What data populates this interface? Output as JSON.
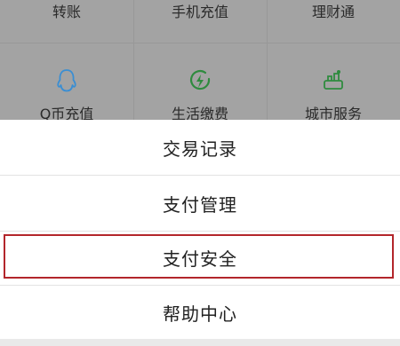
{
  "grid": {
    "row1": [
      {
        "label": "转账"
      },
      {
        "label": "手机充值"
      },
      {
        "label": "理财通"
      }
    ],
    "row2": [
      {
        "label": "Q币充值",
        "icon": "penguin-outline-icon",
        "color": "#3a8ed3"
      },
      {
        "label": "生活缴费",
        "icon": "bolt-ring-icon",
        "color": "#2e8b3e"
      },
      {
        "label": "城市服务",
        "icon": "city-service-icon",
        "color": "#2e8b3e"
      }
    ]
  },
  "sheet": {
    "items": [
      {
        "label": "交易记录"
      },
      {
        "label": "支付管理"
      },
      {
        "label": "支付安全"
      },
      {
        "label": "帮助中心"
      }
    ],
    "highlight_color": "#b3262b"
  }
}
